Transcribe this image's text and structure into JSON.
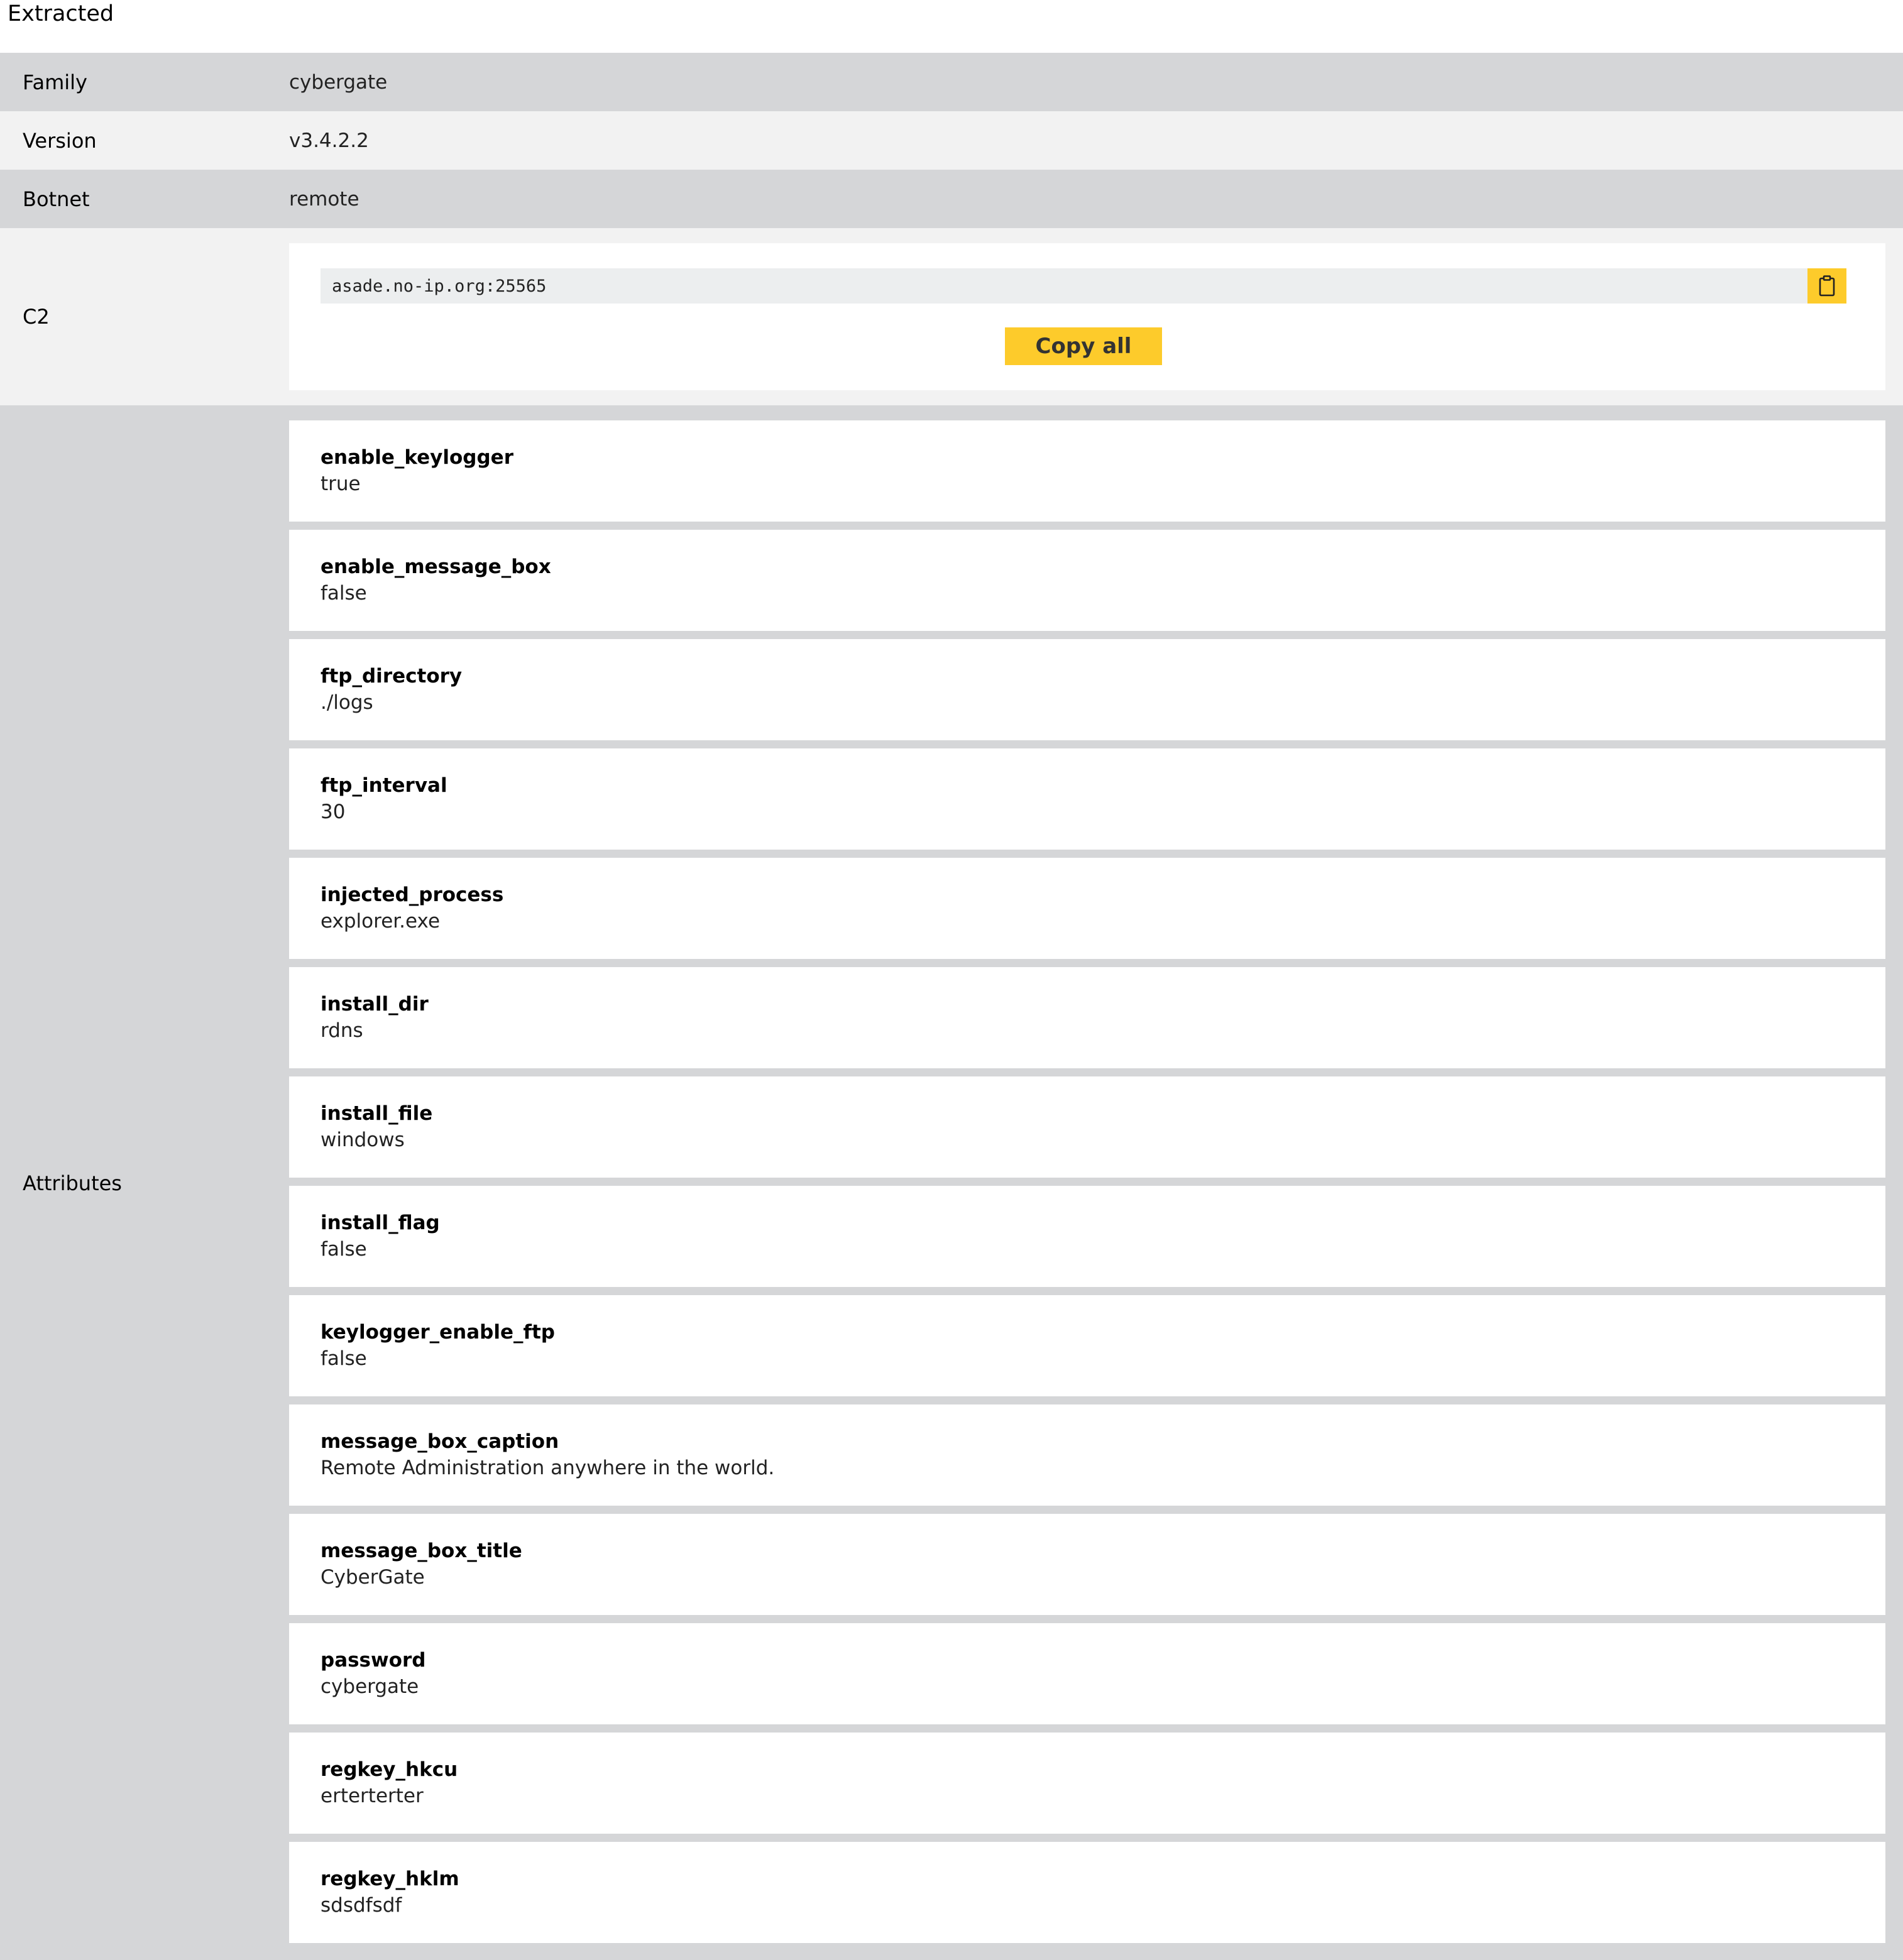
{
  "heading": "Extracted",
  "rows": {
    "family": {
      "label": "Family",
      "value": "cybergate"
    },
    "version": {
      "label": "Version",
      "value": "v3.4.2.2"
    },
    "botnet": {
      "label": "Botnet",
      "value": "remote"
    }
  },
  "c2": {
    "label": "C2",
    "entries": [
      "asade.no-ip.org:25565"
    ],
    "copy_icon": "clipboard-icon",
    "copy_all_label": "Copy all"
  },
  "attributes": {
    "label": "Attributes",
    "items": [
      {
        "key": "enable_keylogger",
        "value": "true"
      },
      {
        "key": "enable_message_box",
        "value": "false"
      },
      {
        "key": "ftp_directory",
        "value": "./logs"
      },
      {
        "key": "ftp_interval",
        "value": "30"
      },
      {
        "key": "injected_process",
        "value": "explorer.exe"
      },
      {
        "key": "install_dir",
        "value": "rdns"
      },
      {
        "key": "install_file",
        "value": "windows"
      },
      {
        "key": "install_flag",
        "value": "false"
      },
      {
        "key": "keylogger_enable_ftp",
        "value": "false"
      },
      {
        "key": "message_box_caption",
        "value": "Remote Administration anywhere in the world."
      },
      {
        "key": "message_box_title",
        "value": "CyberGate"
      },
      {
        "key": "password",
        "value": "cybergate"
      },
      {
        "key": "regkey_hkcu",
        "value": "erterterter"
      },
      {
        "key": "regkey_hklm",
        "value": "sdsdfsdf"
      }
    ]
  },
  "colors": {
    "accent": "#fdcb2b",
    "row_dark": "#d5d6d8",
    "row_light": "#f2f2f2"
  }
}
